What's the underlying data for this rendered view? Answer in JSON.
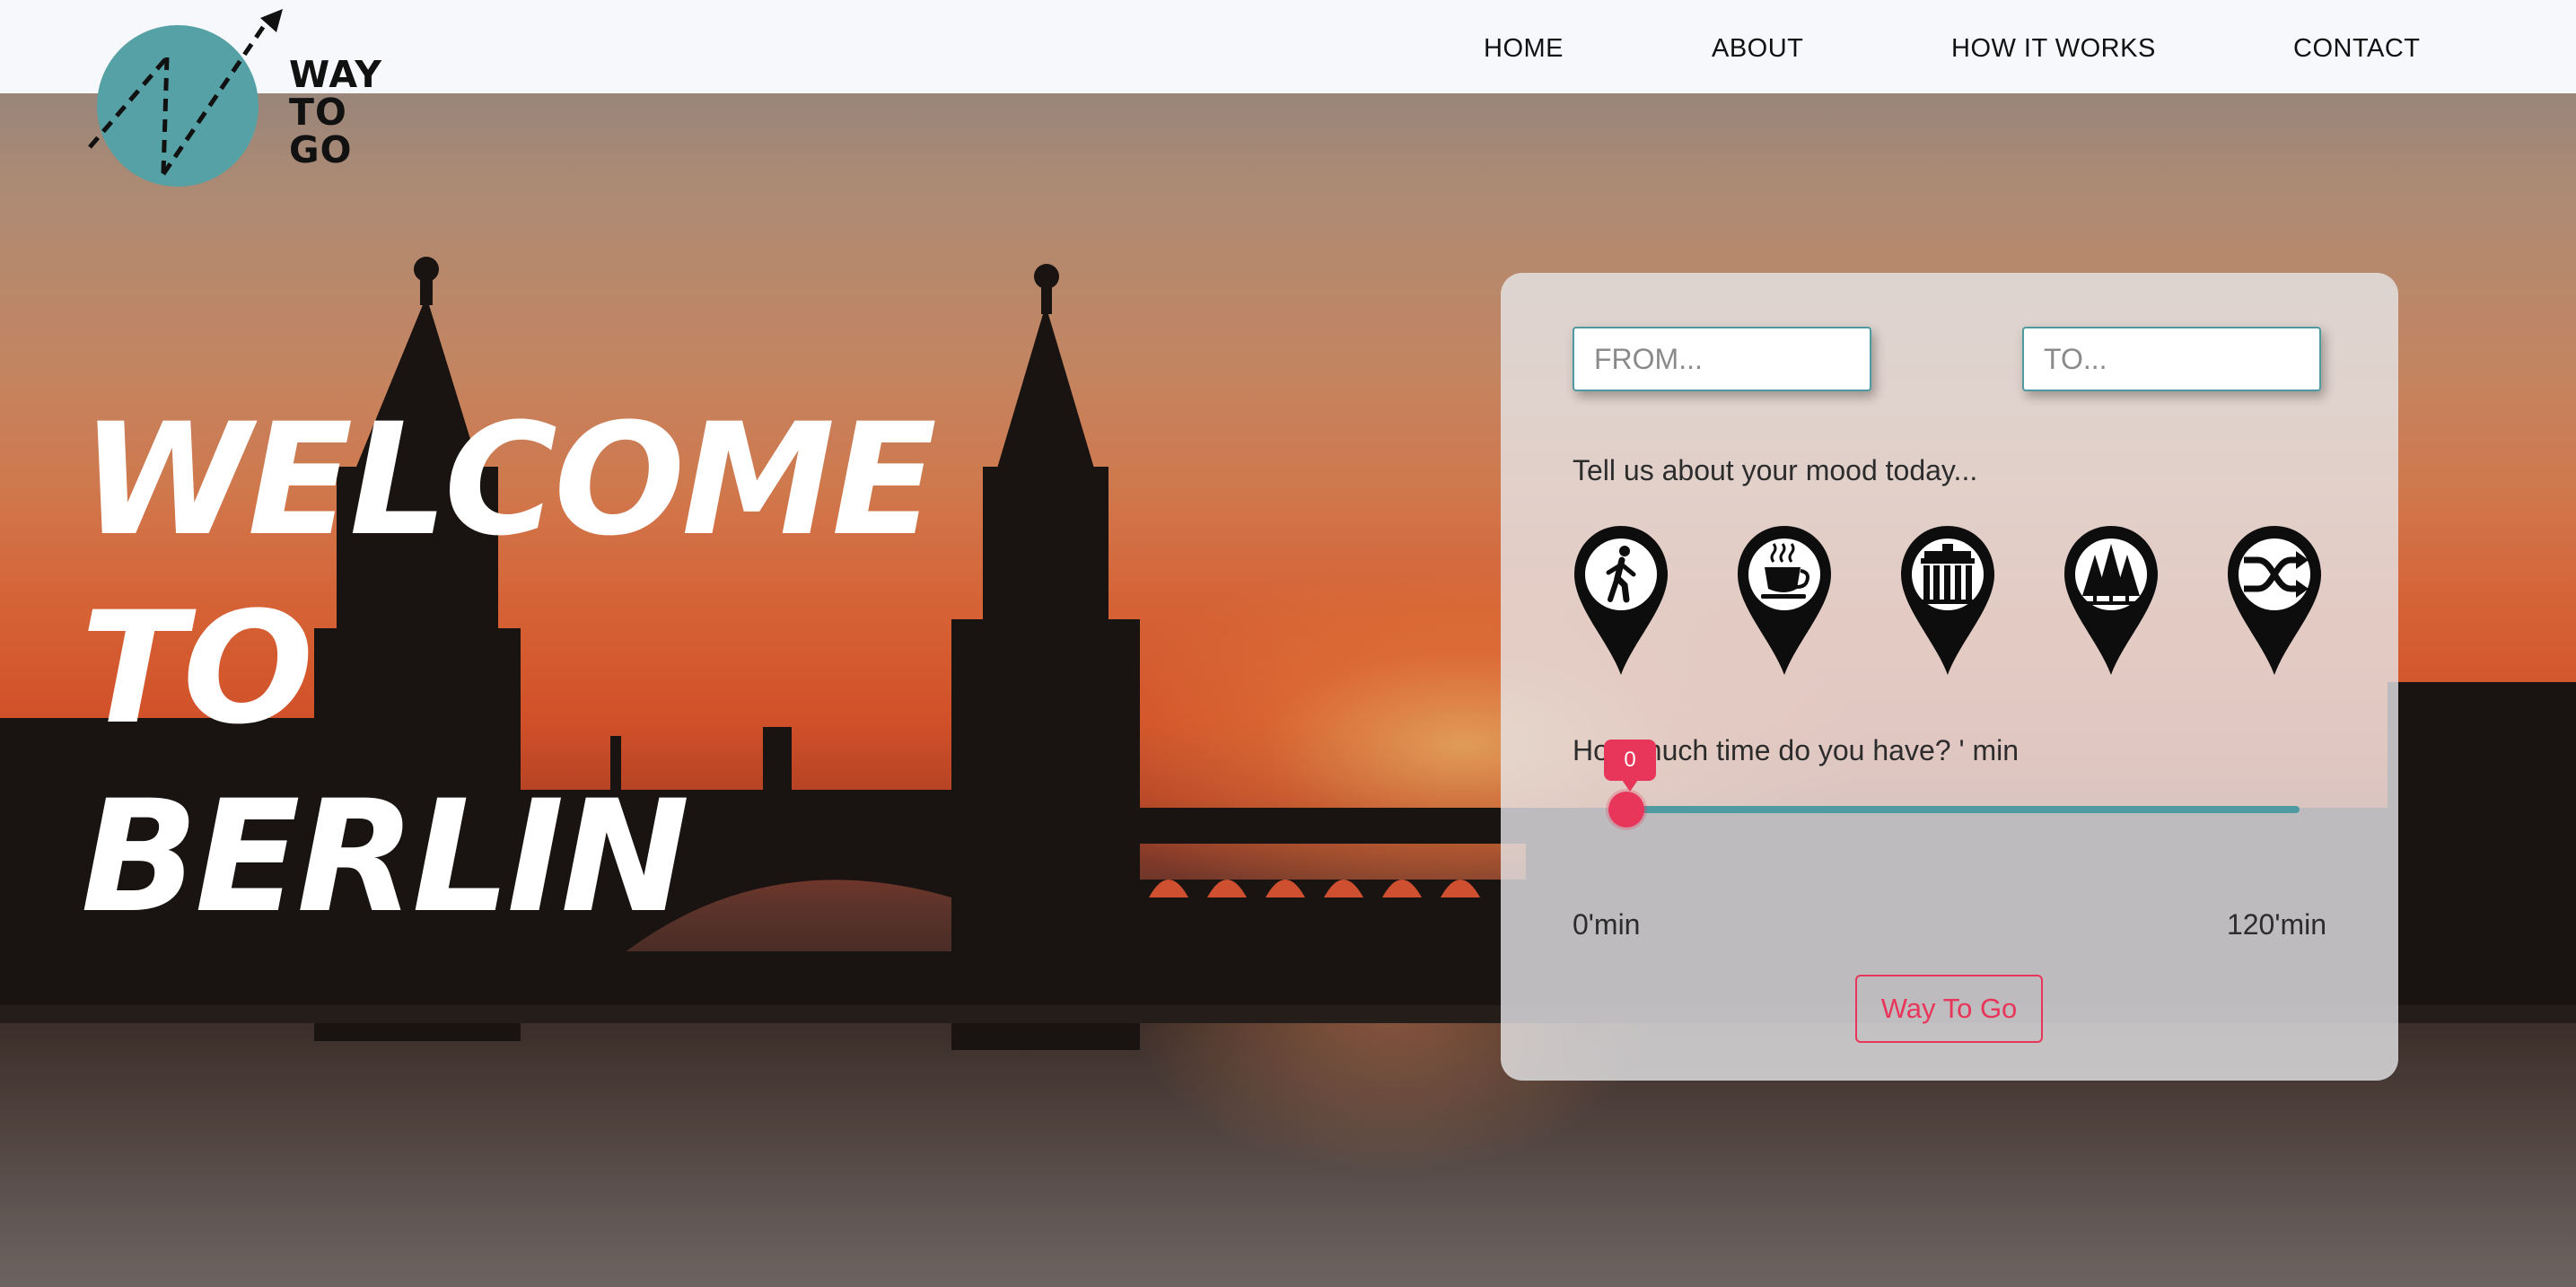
{
  "page": {
    "title": "Way To Go"
  },
  "header": {
    "logo": {
      "word_line1": "WAY",
      "word_line2": "TO",
      "word_line3": "GO"
    },
    "nav": [
      {
        "label": "HOME"
      },
      {
        "label": "ABOUT"
      },
      {
        "label": "HOW IT WORKS"
      },
      {
        "label": "CONTACT"
      }
    ]
  },
  "hero": {
    "line1": "WELCOME",
    "line2": "TO",
    "line3": "BERLIN",
    "background": "berlin-sunset-bridge-photo"
  },
  "planner": {
    "from_placeholder": "FROM...",
    "to_placeholder": "TO...",
    "mood_label": "Tell us about your mood today...",
    "moods": [
      {
        "icon": "walking-person-icon"
      },
      {
        "icon": "coffee-cup-icon"
      },
      {
        "icon": "brandenburg-gate-icon"
      },
      {
        "icon": "trees-icon"
      },
      {
        "icon": "shuffle-icon"
      }
    ],
    "time_label": "How much time do you have? ' min",
    "slider": {
      "value": 0,
      "value_label": "0",
      "min": 0,
      "max": 120
    },
    "min_label": "0'min",
    "max_label": "120'min",
    "submit_label": "Way To Go"
  },
  "colors": {
    "accent_teal": "#4f9aa0",
    "accent_red": "#e8365a",
    "navbar_bg": "#f7f8fc",
    "logo_circle": "#55a1a5"
  }
}
